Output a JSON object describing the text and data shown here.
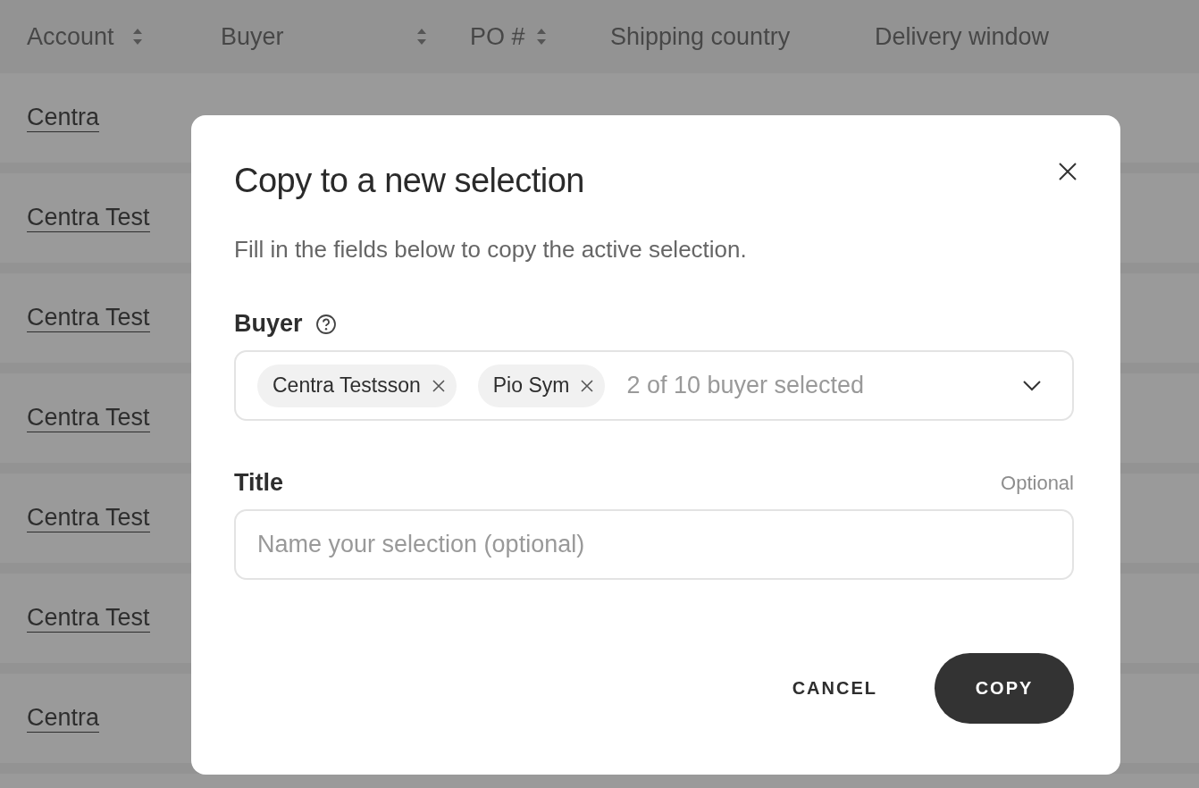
{
  "table": {
    "columns": [
      {
        "label": "Account",
        "sortable": true
      },
      {
        "label": "Buyer",
        "sortable": true
      },
      {
        "label": "PO #",
        "sortable": true
      },
      {
        "label": "Shipping country",
        "sortable": false
      },
      {
        "label": "Delivery window",
        "sortable": false
      }
    ],
    "rows": [
      {
        "account": "Centra"
      },
      {
        "account": "Centra Test"
      },
      {
        "account": "Centra Test"
      },
      {
        "account": "Centra Test"
      },
      {
        "account": "Centra Test"
      },
      {
        "account": "Centra Test"
      },
      {
        "account": "Centra"
      }
    ]
  },
  "dialog": {
    "title": "Copy to a new selection",
    "description": "Fill in the fields below to copy the active selection.",
    "buyer_field": {
      "label": "Buyer",
      "chips": [
        "Centra Testsson",
        "Pio Sym"
      ],
      "summary": "2 of 10 buyer selected"
    },
    "title_field": {
      "label": "Title",
      "hint": "Optional",
      "placeholder": "Name your selection (optional)"
    },
    "buttons": [
      {
        "label": "CANCEL",
        "kind": "text"
      },
      {
        "label": "COPY",
        "kind": "primary"
      }
    ]
  }
}
